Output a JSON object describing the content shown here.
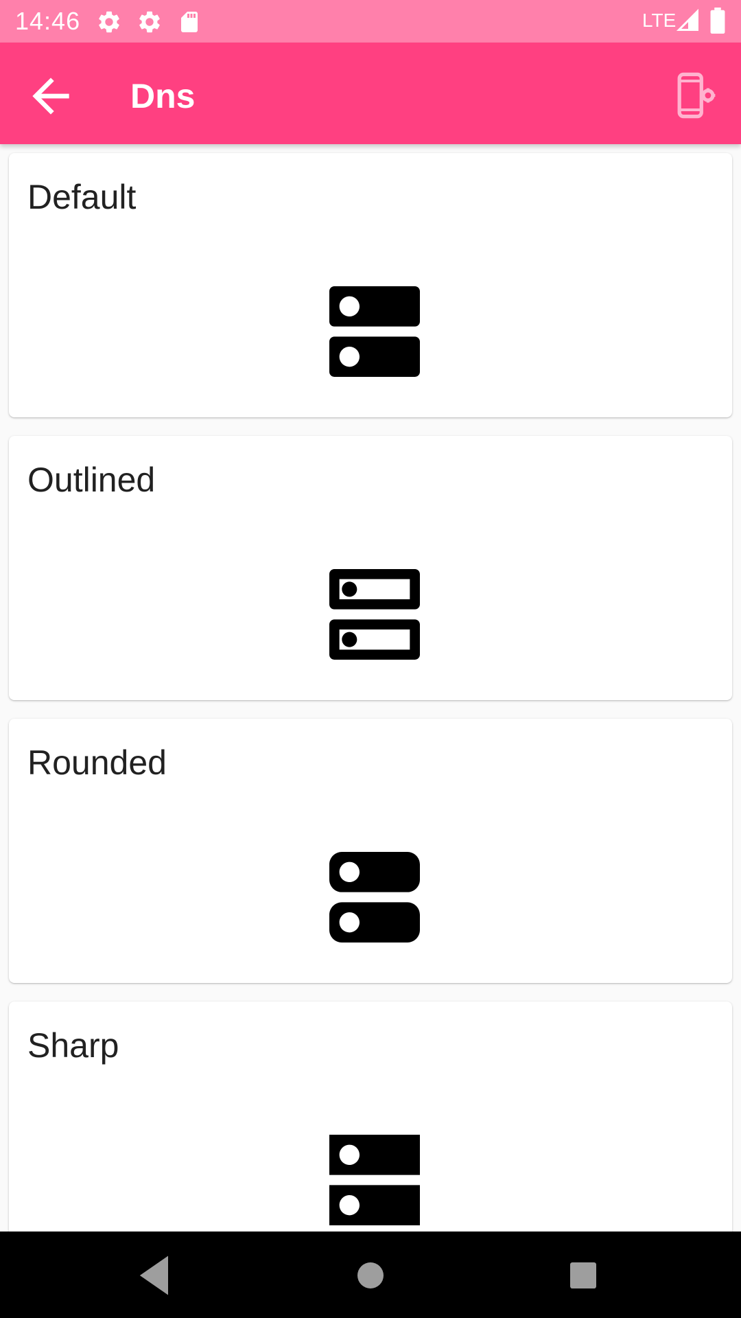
{
  "status_bar": {
    "time": "14:46",
    "network": "LTE",
    "icons": [
      "gear-icon",
      "gear-icon",
      "sd-card-icon",
      "signal-icon",
      "battery-icon"
    ],
    "background": "#ff80ab"
  },
  "app_bar": {
    "title": "Dns",
    "background": "#ff4081",
    "icons": [
      "arrow-back-icon",
      "phone-settings-icon"
    ]
  },
  "cards": [
    {
      "label": "Default",
      "icon": "dns-filled-icon"
    },
    {
      "label": "Outlined",
      "icon": "dns-outlined-icon"
    },
    {
      "label": "Rounded",
      "icon": "dns-rounded-icon"
    },
    {
      "label": "Sharp",
      "icon": "dns-sharp-icon"
    }
  ],
  "nav_bar": {
    "icons": [
      "back-triangle-icon",
      "home-circle-icon",
      "recents-square-icon"
    ]
  }
}
